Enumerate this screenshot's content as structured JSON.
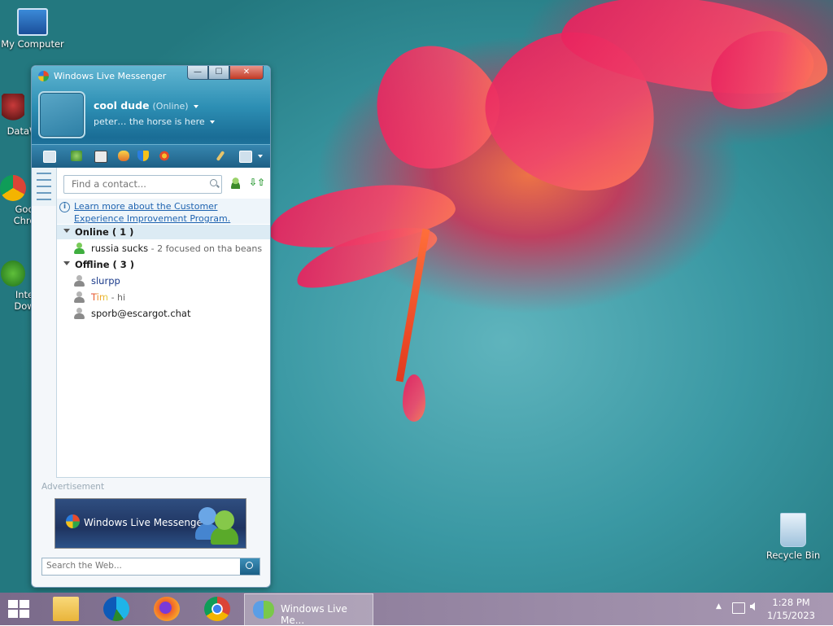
{
  "desktop": {
    "icons": [
      {
        "label": "My Computer"
      },
      {
        "label": "DataW"
      },
      {
        "label": "Goo Chro"
      },
      {
        "label": "Inte Dow"
      },
      {
        "label": "Recycle Bin"
      }
    ]
  },
  "messenger": {
    "window_title": "Windows Live Messenger",
    "controls": {
      "minimize": "—",
      "maximize": "☐",
      "close": "✕"
    },
    "user": {
      "name": "cool dude",
      "status": "(Online)",
      "personal_message": "peter… the horse is here"
    },
    "toolbar_icons": [
      "mail-icon",
      "contacts-icon",
      "photo-icon",
      "games-icon",
      "shield-icon",
      "flower-icon",
      "paintbrush-icon",
      "menu-icon"
    ],
    "search": {
      "placeholder": "Find a contact..."
    },
    "info_link": "Learn more about the Customer Experience Improvement Program.",
    "groups": [
      {
        "label": "Online ( 1 )",
        "contacts": [
          {
            "name": "russia sucks",
            "message": " - 2 focused on tha beans",
            "status": "online"
          }
        ]
      },
      {
        "label": "Offline ( 3 )",
        "contacts": [
          {
            "name": "slurpp",
            "message": "",
            "status": "offline"
          },
          {
            "name": "Tim",
            "message": " - hi",
            "status": "offline"
          },
          {
            "name": "sporb@escargot.chat",
            "message": "",
            "status": "offline"
          }
        ]
      }
    ],
    "ad_label": "Advertisement",
    "ad_text": "Windows Live Messenger",
    "web_search": {
      "placeholder": "Search the Web..."
    }
  },
  "taskbar": {
    "active_task": "Windows Live Me...",
    "time": "1:28 PM",
    "date": "1/15/2023",
    "tray_arrow": "▲"
  },
  "colors": {
    "accent": "#2d8fb4",
    "online": "#3fae3f",
    "offline": "#8a8a8a",
    "link": "#1e63b0"
  }
}
